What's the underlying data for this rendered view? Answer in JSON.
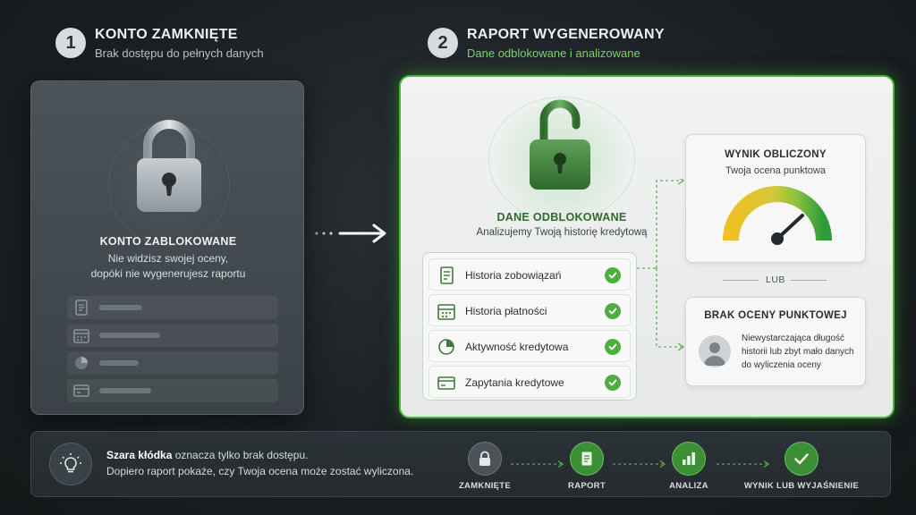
{
  "step1": {
    "number": "1",
    "title": "KONTO ZAMKNIĘTE",
    "subtitle": "Brak dostępu do pełnych danych"
  },
  "step2": {
    "number": "2",
    "title": "RAPORT WYGENEROWANY",
    "subtitle": "Dane odblokowane i analizowane"
  },
  "locked_panel": {
    "title": "KONTO ZABLOKOWANE",
    "text_line1": "Nie widzisz swojej oceny,",
    "text_line2": "dopóki nie wygenerujesz raportu",
    "rows": [
      {
        "icon": "document-icon"
      },
      {
        "icon": "calendar-icon"
      },
      {
        "icon": "pie-chart-icon"
      },
      {
        "icon": "credit-card-icon"
      }
    ]
  },
  "unlocked_panel": {
    "title": "DANE ODBLOKOWANE",
    "text": "Analizujemy Twoją historię kredytową",
    "items": [
      {
        "label": "Historia zobowiązań",
        "icon": "document-icon",
        "checked": true
      },
      {
        "label": "Historia płatności",
        "icon": "calendar-icon",
        "checked": true
      },
      {
        "label": "Aktywność kredytowa",
        "icon": "pie-chart-icon",
        "checked": true
      },
      {
        "label": "Zapytania kredytowe",
        "icon": "credit-card-icon",
        "checked": true
      }
    ],
    "score_card": {
      "title": "WYNIK OBLICZONY",
      "subtitle": "Twoja ocena punktowa",
      "icon": "gauge-icon"
    },
    "or_label": "LUB",
    "no_score_card": {
      "title": "BRAK OCENY PUNKTOWEJ",
      "line1": "Niewystarczająca długość",
      "line2": "historii lub zbyt mało danych",
      "line3": "do wyliczenia oceny",
      "icon": "user-avatar-icon"
    }
  },
  "tip": {
    "bold": "Szara kłódka",
    "line1_rest": " oznacza tylko brak dostępu.",
    "line2": "Dopiero raport pokaże, czy Twoja ocena może zostać wyliczona.",
    "icon": "lightbulb-icon"
  },
  "flow": [
    {
      "label": "ZAMKNIĘTE",
      "icon": "lock-icon"
    },
    {
      "label": "RAPORT",
      "icon": "document-icon"
    },
    {
      "label": "ANALIZA",
      "icon": "bar-chart-icon"
    },
    {
      "label": "WYNIK LUB WYJAŚNIENIE",
      "icon": "check-icon"
    }
  ],
  "colors": {
    "accent_green": "#4caf3e",
    "locked_gray": "#4b5359",
    "background": "#1a1f23"
  }
}
